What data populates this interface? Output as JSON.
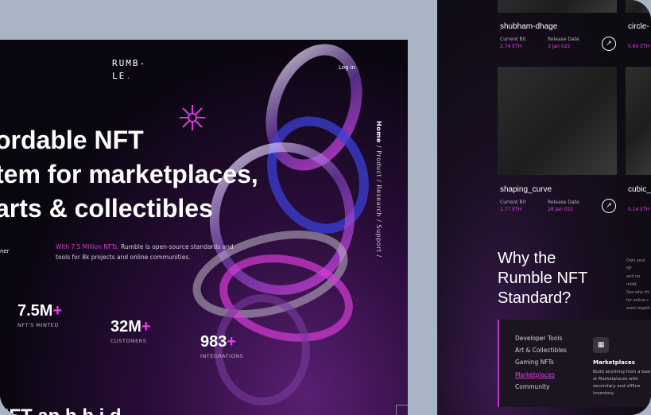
{
  "left": {
    "logo_line1": "RUMB-",
    "logo_line2": "LE",
    "logo_dot": ".",
    "login": "Log in",
    "hero_line1": "ordable NFT",
    "hero_line2": "tem for marketplaces,",
    "hero_line3": "arts & collectibles",
    "vnav_active": "Home",
    "vnav_rest": " / Product / Research / Support /",
    "stub_text": "ner",
    "desc_highlight": "With 7.5 Million NFTs,",
    "desc_rest": " Rumble is open-source standards and tools for 8k projects and online communities.",
    "stats": [
      {
        "num": "7.5M",
        "plus": "+",
        "label": "NFT'S MINTED"
      },
      {
        "num": "32M",
        "plus": "+",
        "label": "CUSTOMERS"
      },
      {
        "num": "983",
        "plus": "+",
        "label": "INTEGRATIONS"
      }
    ],
    "bottom_text": "NFT an  h  b  i  d"
  },
  "right": {
    "cards": [
      {
        "title": "shubham-dhage",
        "bit_label": "Current Bit",
        "bit": "2.74 ETH",
        "date_label": "Release Date",
        "date": "3 Jan 022"
      },
      {
        "title": "circle-",
        "bit": "0.60 ETH"
      },
      {
        "title": "shaping_curve",
        "bit_label": "Current Bit",
        "bit": "1.77 ETH",
        "date_label": "Release Date",
        "date": "28 Jan 022"
      },
      {
        "title": "cubic_",
        "bit": "0.14 ETH"
      }
    ],
    "why_line1": "Why the",
    "why_line2": "Rumble NFT",
    "why_line3": "Standard?",
    "side_small_lines": [
      "Own your NF",
      "and no midd",
      "See why thi",
      "for online c",
      "work togeth"
    ],
    "menu": [
      "Developer Tools",
      "Art & Collectibles",
      "Gaming NFTs",
      "Marketplaces",
      "Community"
    ],
    "menu_active_index": 3,
    "market_title": "Marketplaces",
    "market_desc": "Build anything from a basic st Marketplaces with secondary and offline inventory."
  },
  "colors": {
    "accent": "#e040e8",
    "background": "#a9b4c5"
  }
}
